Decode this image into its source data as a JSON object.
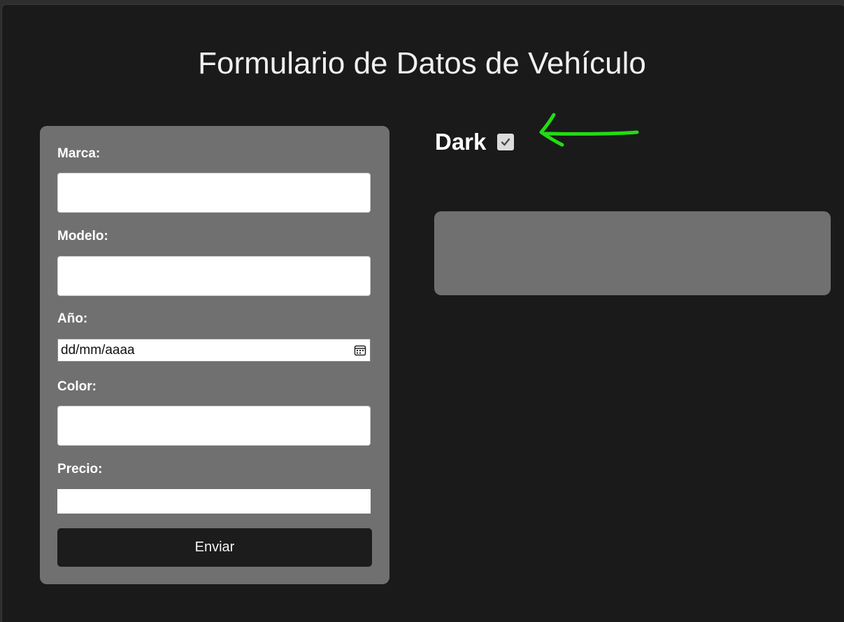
{
  "page": {
    "title": "Formulario de Datos de Vehículo"
  },
  "form": {
    "fields": [
      {
        "label": "Marca:",
        "value": ""
      },
      {
        "label": "Modelo:",
        "value": ""
      },
      {
        "label": "Año:",
        "value": "",
        "placeholder": "dd/mm/aaaa"
      },
      {
        "label": "Color:",
        "value": ""
      },
      {
        "label": "Precio:",
        "value": ""
      }
    ],
    "submit_label": "Enviar"
  },
  "theme_toggle": {
    "label": "Dark",
    "checked": true
  },
  "result_panel": {
    "content": ""
  },
  "colors": {
    "background": "#1a1a1a",
    "card": "#707070",
    "button": "#1c1c1c",
    "annotation_arrow": "#22dd11"
  },
  "icons": {
    "date_picker": "calendar-icon",
    "toggle_check": "checkmark-icon",
    "annotation": "arrow-left-annotation"
  }
}
